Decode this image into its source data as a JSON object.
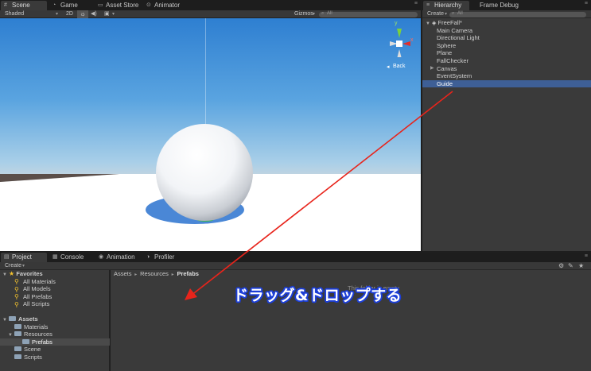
{
  "scene_tabs": [
    {
      "label": "Scene",
      "icon": "scene-grid-icon"
    },
    {
      "label": "Game",
      "icon": "game-pacman-icon"
    },
    {
      "label": "Asset Store",
      "icon": "store-cart-icon"
    },
    {
      "label": "Animator",
      "icon": "animator-icon"
    }
  ],
  "scene_toolbar": {
    "shading_mode": "Shaded",
    "toggle_2d": "2D",
    "gizmos_label": "Gizmos",
    "search_placeholder": "All"
  },
  "scene_gizmo": {
    "y_label": "y",
    "x_label": "x",
    "view_label": "Back"
  },
  "hierarchy": {
    "tabs": [
      "Hierarchy",
      "Frame Debug"
    ],
    "create_label": "Create",
    "search_placeholder": "All",
    "scene_name": "FreeFall*",
    "items": [
      "Main Camera",
      "Directional Light",
      "Sphere",
      "Plane",
      "FallChecker",
      "Canvas",
      "EventSystem",
      "Guide"
    ],
    "selected_item": "Guide"
  },
  "project": {
    "tabs": [
      "Project",
      "Console",
      "Animation",
      "Profiler"
    ],
    "create_label": "Create",
    "favorites_label": "Favorites",
    "favorites": [
      "All Materials",
      "All Models",
      "All Prefabs",
      "All Scripts"
    ],
    "assets_label": "Assets",
    "folders": [
      {
        "label": "Materials",
        "depth": 1
      },
      {
        "label": "Resources",
        "depth": 1
      },
      {
        "label": "Prefabs",
        "depth": 2,
        "selected": true
      },
      {
        "label": "Scene",
        "depth": 1
      },
      {
        "label": "Scripts",
        "depth": 1
      }
    ],
    "breadcrumb": [
      "Assets",
      "Resources",
      "Prefabs"
    ],
    "empty_message": "This folder is empty"
  },
  "annotation": {
    "text": "ドラッグ&ドロップする",
    "arrow_color": "#e8241b",
    "text_outline_color": "#1c3fd8"
  },
  "colors": {
    "panel_bg": "#3a3a3a",
    "selection": "#3e5f96",
    "sky_top": "#2e7fd1",
    "ground": "#5b4e49"
  }
}
